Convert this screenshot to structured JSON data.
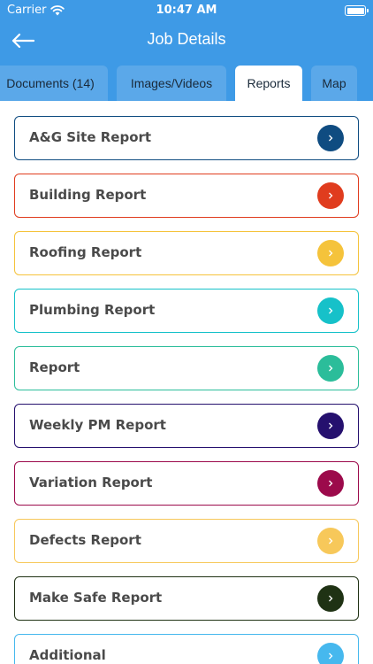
{
  "status": {
    "carrier": "Carrier",
    "time": "10:47 AM"
  },
  "nav": {
    "title": "Job Details"
  },
  "tabs": [
    {
      "label": "Documents (14)",
      "active": false
    },
    {
      "label": "Images/Videos",
      "active": false
    },
    {
      "label": "Reports",
      "active": true
    },
    {
      "label": "Map",
      "active": false
    }
  ],
  "reports": [
    {
      "label": "A&G Site Report",
      "color": "#0f4c81"
    },
    {
      "label": "Building Report",
      "color": "#e03c1e"
    },
    {
      "label": "Roofing Report",
      "color": "#f5c33b"
    },
    {
      "label": "Plumbing Report",
      "color": "#16c1c9"
    },
    {
      "label": "Report",
      "color": "#2bbd9a"
    },
    {
      "label": "Weekly PM Report",
      "color": "#25106e"
    },
    {
      "label": "Variation Report",
      "color": "#9c0a4b"
    },
    {
      "label": "Defects Report",
      "color": "#f7c85a"
    },
    {
      "label": "Make Safe Report",
      "color": "#1f3214"
    },
    {
      "label": "Additional",
      "color": "#46b8ee"
    }
  ]
}
